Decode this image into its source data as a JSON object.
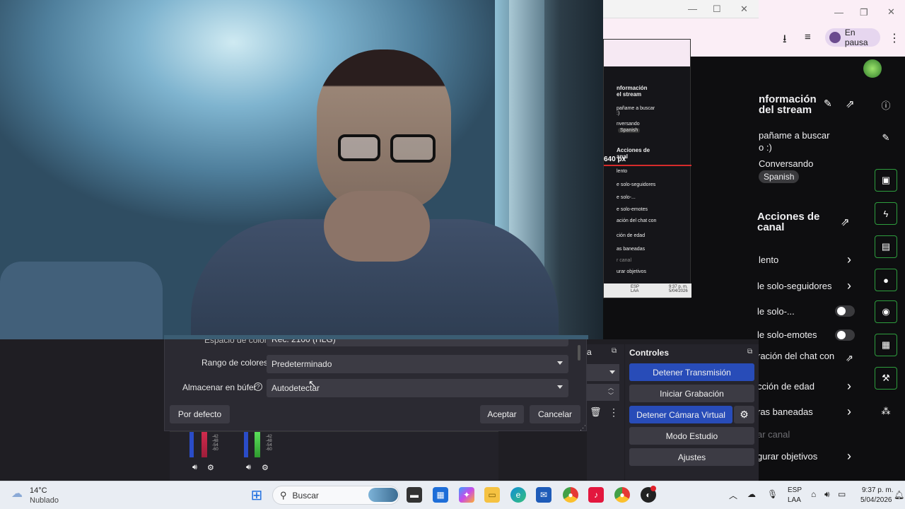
{
  "browser": {
    "pause_label": "En pausa"
  },
  "preview": {
    "info_title": "nformación\nel stream",
    "subtitle": "pañame a buscar\n:)",
    "conversando": "nversando",
    "spanish": "Spanish",
    "px_label": "640 px",
    "actions_title": "Acciones de\nanal",
    "items": [
      "lento",
      "e solo-seguidores",
      "e solo-...",
      "e solo-emotes",
      "ación del chat con",
      "ción de edad",
      "as baneadas",
      "r canal",
      "urar objetivos"
    ],
    "bottom_lang": "ESP\nLAA",
    "bottom_time": "9:37 p. m.\n5/04/2026"
  },
  "panel": {
    "info_title_1": "nformación",
    "info_title_2": "del stream",
    "stream_title_1": "pañame a buscar",
    "stream_title_2": "o :)",
    "category": "Conversando",
    "tag": "Spanish",
    "actions_title_1": "Acciones de",
    "actions_title_2": "canal",
    "actions": [
      {
        "label": "lento"
      },
      {
        "label": "le solo-seguidores"
      },
      {
        "label": "le solo-..."
      },
      {
        "label": "le solo-emotes"
      },
      {
        "label": "ración del chat con"
      },
      {
        "label": "cción de edad"
      },
      {
        "label": "ras baneadas"
      },
      {
        "label": "ar canal"
      },
      {
        "label": "gurar objetivos"
      }
    ]
  },
  "settings": {
    "partial_label": "Espacio de color",
    "partial_value": "Rec. 2100 (HLG)",
    "color_range_label": "Rango de colores",
    "color_range_value": "Predeterminado",
    "buffer_label": "Almacenar en búfer",
    "buffer_value": "Autodetectar",
    "defaults_button": "Por defecto",
    "accept_button": "Aceptar",
    "cancel_button": "Cancelar"
  },
  "mixer": {
    "db_ticks": [
      "-42",
      "-48",
      "-54",
      "-60"
    ]
  },
  "scenes_panel": {
    "header_fragment": "a"
  },
  "controls": {
    "title": "Controles",
    "buttons": [
      "Detener Transmisión",
      "Iniciar Grabación",
      "Detener Cámara Virtual",
      "Modo Estudio",
      "Ajustes"
    ]
  },
  "taskbar": {
    "temperature": "14°C",
    "weather": "Nublado",
    "search_placeholder": "Buscar",
    "lang_1": "ESP",
    "lang_2": "LAA",
    "time": "9:37 p. m.",
    "date": "5/04/2026"
  },
  "colors": {
    "obs_active": "#284cb8",
    "accent_green": "#2e9e3e",
    "live_red": "#d62b2b"
  }
}
